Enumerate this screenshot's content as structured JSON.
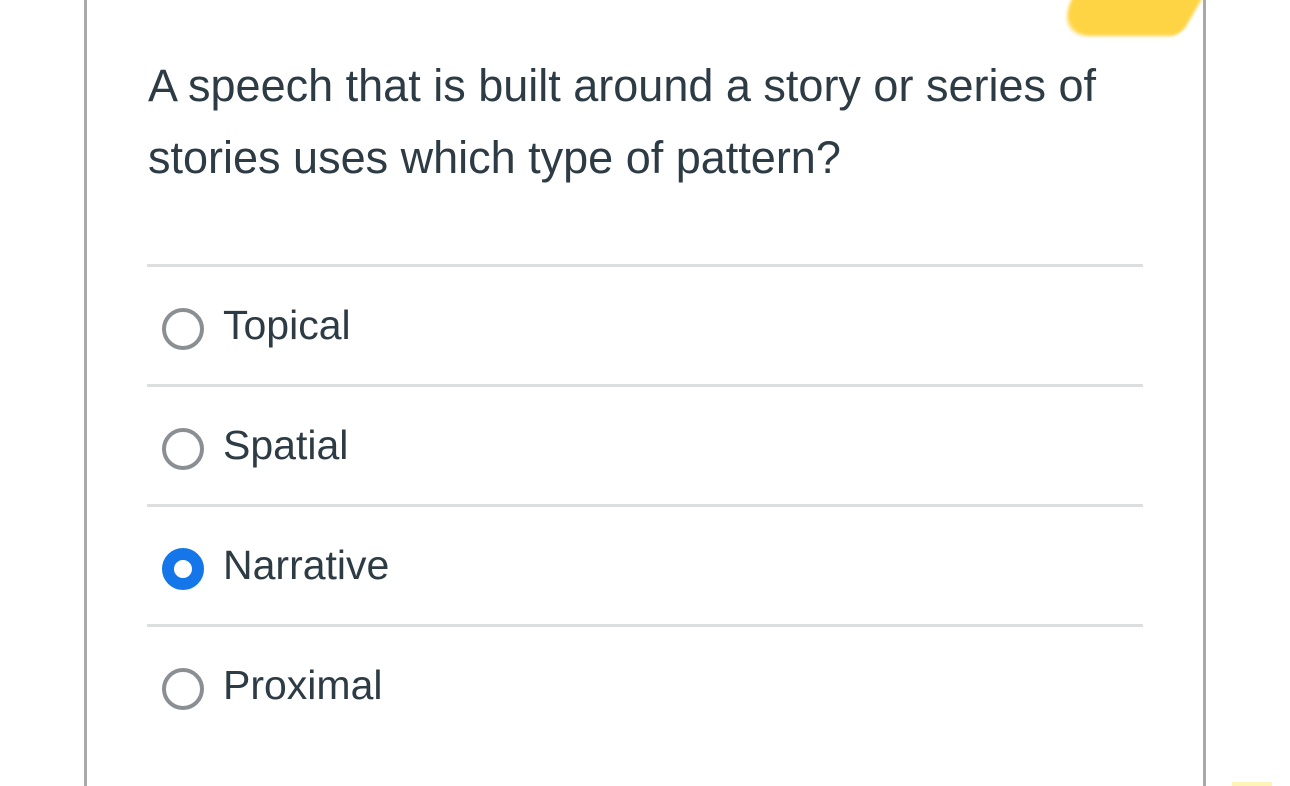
{
  "question": {
    "text": "A speech that is built around a story or series of stories uses which type of pattern?"
  },
  "answers": [
    {
      "label": "Topical",
      "selected": false
    },
    {
      "label": "Spatial",
      "selected": false
    },
    {
      "label": "Narrative",
      "selected": true
    },
    {
      "label": "Proximal",
      "selected": false
    }
  ],
  "colors": {
    "accent": "#1476e8",
    "text": "#2d3b45",
    "divider": "#dcdee0",
    "highlighter": "#ffd23a"
  }
}
